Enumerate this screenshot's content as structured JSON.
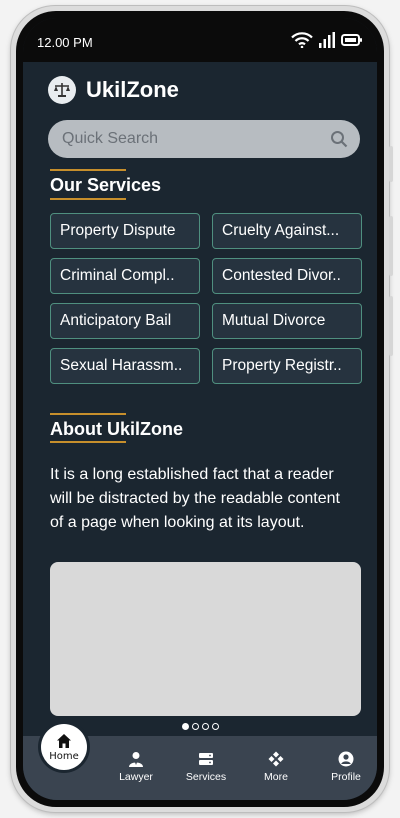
{
  "status_bar": {
    "time": "12.00 PM"
  },
  "app": {
    "title": "UkilZone"
  },
  "search": {
    "placeholder": "Quick Search"
  },
  "services_section": {
    "title": "Our Services",
    "items": [
      "Property Dispute",
      "Cruelty Against...",
      "Criminal Compl..",
      "Contested Divor..",
      "Anticipatory Bail",
      "Mutual Divorce",
      "Sexual Harassm..",
      "Property Registr.."
    ]
  },
  "about_section": {
    "title": "About UkilZone",
    "text": "It is a long established fact that a reader will be distracted by the readable content of a page when looking at its layout."
  },
  "carousel": {
    "slide_count": 4,
    "active_index": 0
  },
  "bottom_nav": {
    "items": [
      {
        "label": "Home",
        "icon": "home-icon",
        "active": true
      },
      {
        "label": "Lawyer",
        "icon": "lawyer-icon"
      },
      {
        "label": "Services",
        "icon": "services-icon"
      },
      {
        "label": "More",
        "icon": "more-icon"
      },
      {
        "label": "Profile",
        "icon": "profile-icon"
      }
    ]
  },
  "colors": {
    "background": "#1b2630",
    "accent": "#c78f2c",
    "chip_border": "#4f8f7f",
    "nav_bar": "#3a4450"
  }
}
